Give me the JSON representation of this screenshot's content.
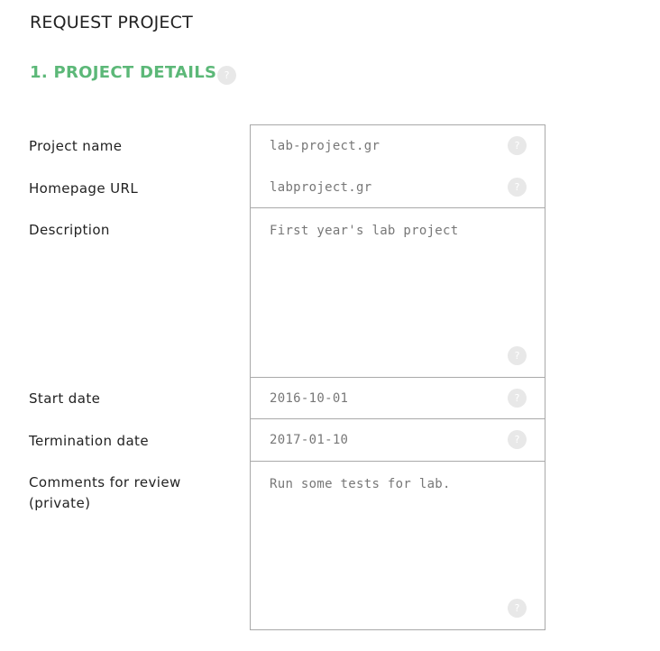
{
  "header": {
    "title": "REQUEST PROJECT"
  },
  "section": {
    "title": "1. PROJECT DETAILS",
    "help_icon": "question-mark-icon"
  },
  "fields": {
    "name": {
      "label": "Project name",
      "value": "lab-project.gr"
    },
    "url": {
      "label": "Homepage URL",
      "value": "labproject.gr"
    },
    "description": {
      "label": "Description",
      "value": "First year's lab project"
    },
    "start_date": {
      "label": "Start date",
      "value": "2016-10-01"
    },
    "end_date": {
      "label": "Termination date",
      "value": "2017-01-10"
    },
    "comments": {
      "label": "Comments for review (private)",
      "value": "Run some tests for lab."
    }
  },
  "help_glyph": "?",
  "colors": {
    "section_accent": "#5cb878",
    "field_border": "#a9a9a9",
    "value_text": "#777777",
    "help_icon_bg": "#e8e8e8"
  }
}
